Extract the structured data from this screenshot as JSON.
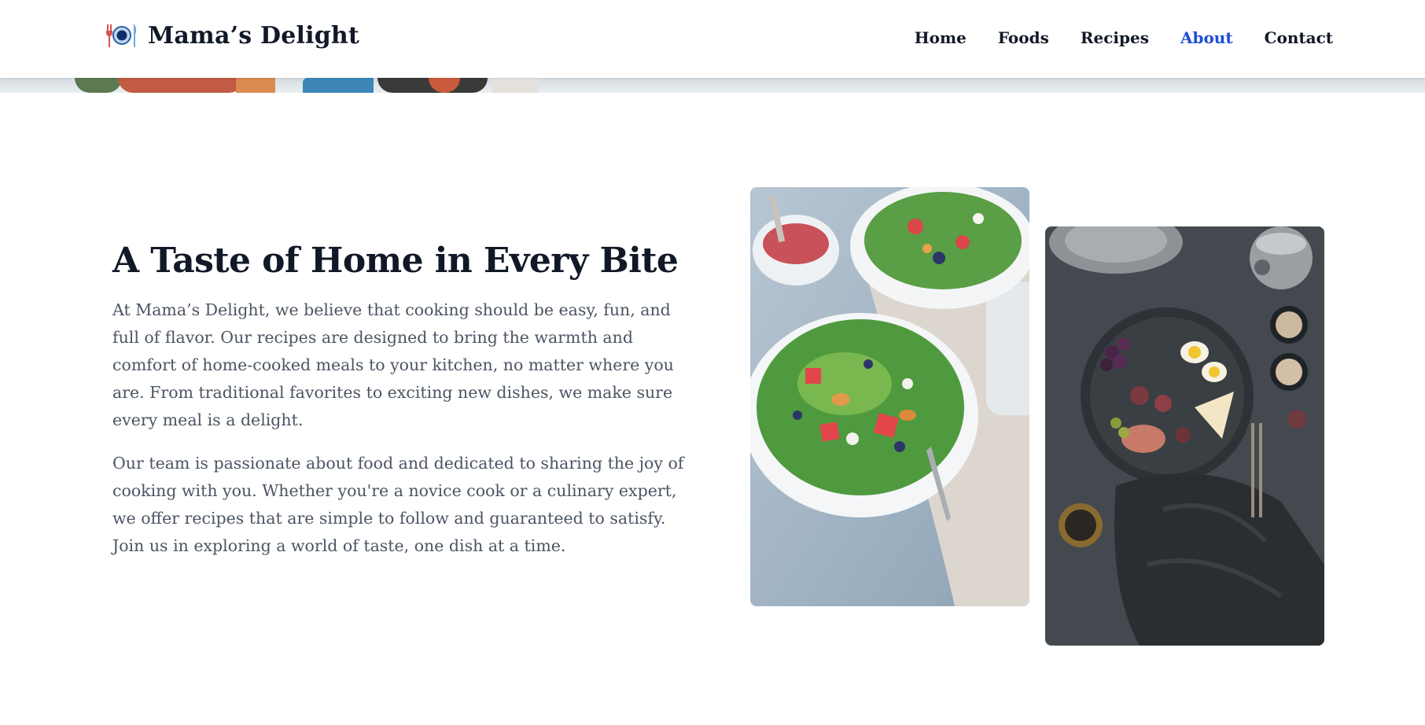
{
  "brand": {
    "name": "Mama’s Delight",
    "icon": "plate-fork-knife-icon"
  },
  "nav": {
    "items": [
      {
        "label": "Home",
        "active": false
      },
      {
        "label": "Foods",
        "active": false
      },
      {
        "label": "Recipes",
        "active": false
      },
      {
        "label": "About",
        "active": true
      },
      {
        "label": "Contact",
        "active": false
      }
    ]
  },
  "about": {
    "title": "A Taste of Home in Every Bite",
    "paragraphs": [
      "At Mama’s Delight, we believe that cooking should be easy, fun, and full of flavor. Our recipes are designed to bring the warmth and comfort of home-cooked meals to your kitchen, no matter where you are. From traditional favorites to exciting new dishes, we make sure every meal is a delight.",
      "Our team is passionate about food and dedicated to sharing the joy of cooking with you. Whether you're a novice cook or a culinary expert, we offer recipes that are simple to follow and guaranteed to satisfy. Join us in exploring a world of taste, one dish at a time."
    ],
    "images": [
      {
        "name": "salad-photo"
      },
      {
        "name": "platter-photo"
      }
    ]
  },
  "colors": {
    "text_dark": "#111827",
    "text_body": "#4b5563",
    "accent": "#1d4ed8"
  }
}
